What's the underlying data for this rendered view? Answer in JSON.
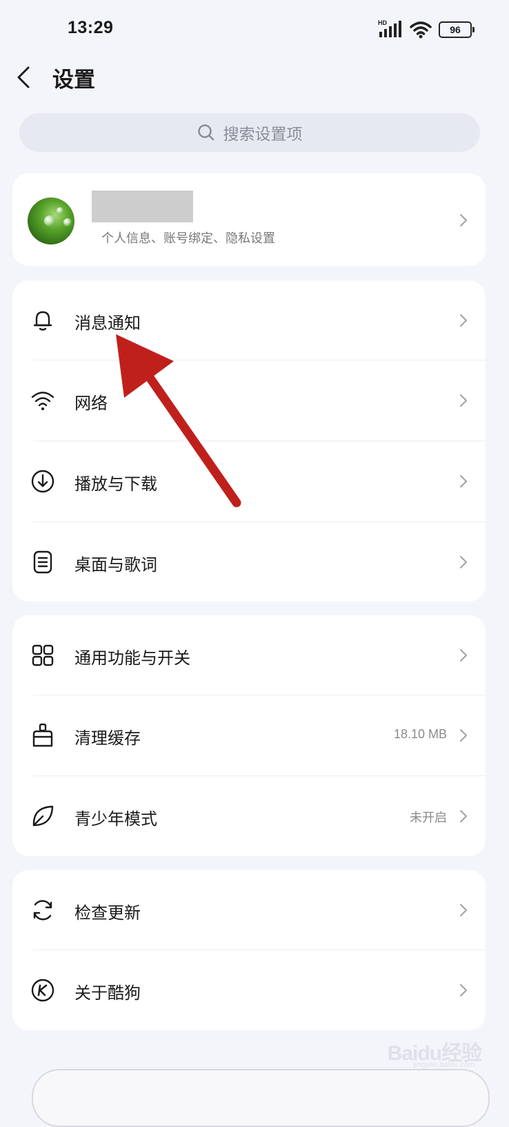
{
  "status_bar": {
    "time": "13:29",
    "network_label": "HD",
    "battery": "96"
  },
  "header": {
    "title": "设置",
    "back_icon": "back-arrow-icon"
  },
  "search": {
    "placeholder": "搜索设置项",
    "icon": "search-icon"
  },
  "profile": {
    "subtitle": "个人信息、账号绑定、隐私设置"
  },
  "groups": [
    {
      "items": [
        {
          "label": "消息通知",
          "icon": "bell-icon"
        },
        {
          "label": "网络",
          "icon": "wifi-icon"
        },
        {
          "label": "播放与下载",
          "icon": "download-icon"
        },
        {
          "label": "桌面与歌词",
          "icon": "lyrics-icon"
        }
      ]
    },
    {
      "items": [
        {
          "label": "通用功能与开关",
          "icon": "grid-icon"
        },
        {
          "label": "清理缓存",
          "icon": "broom-icon",
          "value": "18.10 MB"
        },
        {
          "label": "青少年模式",
          "icon": "leaf-icon",
          "value": "未开启"
        }
      ]
    },
    {
      "items": [
        {
          "label": "检查更新",
          "icon": "refresh-icon"
        },
        {
          "label": "关于酷狗",
          "icon": "kugou-logo-icon"
        }
      ]
    }
  ],
  "watermark": {
    "text": "Baidu经验",
    "sub": "jingyan.baidu.com"
  },
  "colors": {
    "background": "#f4f5fa",
    "card": "#ffffff",
    "arrow": "#c0201c",
    "secondary_text": "#8a8a8a"
  }
}
